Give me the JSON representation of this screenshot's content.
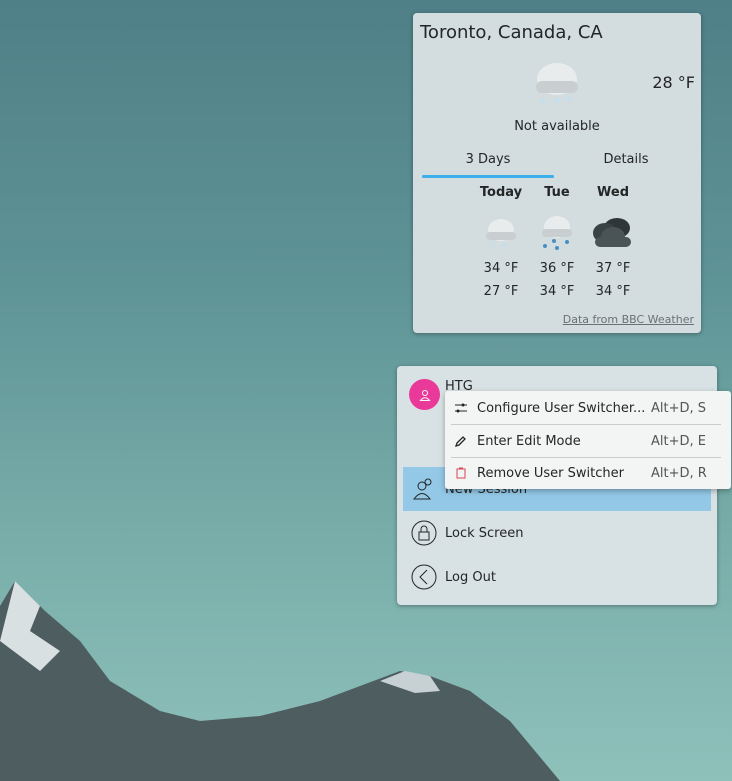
{
  "weather": {
    "location": "Toronto, Canada, CA",
    "current_temp": "28 °F",
    "condition": "Not available",
    "tabs": [
      {
        "label": "3 Days",
        "active": true
      },
      {
        "label": "Details",
        "active": false
      }
    ],
    "days": [
      {
        "name": "Today",
        "icon": "light-snow-icon",
        "high": "34 °F",
        "low": "27 °F"
      },
      {
        "name": "Tue",
        "icon": "snow-icon",
        "high": "36 °F",
        "low": "34 °F"
      },
      {
        "name": "Wed",
        "icon": "overcast-icon",
        "high": "37 °F",
        "low": "34 °F"
      }
    ],
    "credit": "Data from BBC Weather"
  },
  "user_switcher": {
    "username": "HTG",
    "items": [
      {
        "label": "New Session"
      },
      {
        "label": "Lock Screen"
      },
      {
        "label": "Log Out"
      }
    ]
  },
  "context_menu": {
    "items": [
      {
        "label": "Configure User Switcher...",
        "shortcut": "Alt+D, S"
      },
      {
        "label": "Enter Edit Mode",
        "shortcut": "Alt+D, E"
      },
      {
        "label": "Remove User Switcher",
        "shortcut": "Alt+D, R"
      }
    ]
  },
  "colors": {
    "accent": "#3daee9",
    "avatar": "#e93a9a",
    "highlight": "#93c8e6"
  }
}
